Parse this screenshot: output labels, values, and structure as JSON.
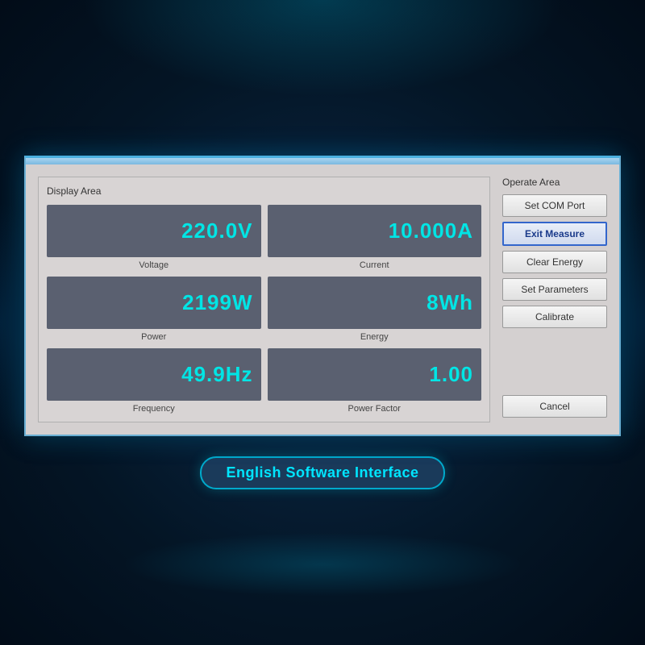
{
  "background": {
    "type": "dark-tech"
  },
  "dialog": {
    "display_area_title": "Display Area",
    "operate_area_title": "Operate Area",
    "meters": [
      {
        "id": "voltage",
        "value": "220.0V",
        "label": "Voltage"
      },
      {
        "id": "current",
        "value": "10.000A",
        "label": "Current"
      },
      {
        "id": "power",
        "value": "2199W",
        "label": "Power"
      },
      {
        "id": "energy",
        "value": "8Wh",
        "label": "Energy"
      },
      {
        "id": "frequency",
        "value": "49.9Hz",
        "label": "Frequency"
      },
      {
        "id": "power-factor",
        "value": "1.00",
        "label": "Power Factor"
      }
    ],
    "buttons": [
      {
        "id": "set-com-port",
        "label": "Set COM Port",
        "active": false
      },
      {
        "id": "exit-measure",
        "label": "Exit Measure",
        "active": true
      },
      {
        "id": "clear-energy",
        "label": "Clear Energy",
        "active": false
      },
      {
        "id": "set-parameters",
        "label": "Set Parameters",
        "active": false
      },
      {
        "id": "calibrate",
        "label": "Calibrate",
        "active": false
      },
      {
        "id": "cancel",
        "label": "Cancel",
        "active": false
      }
    ]
  },
  "bottom_label": "English Software Interface"
}
